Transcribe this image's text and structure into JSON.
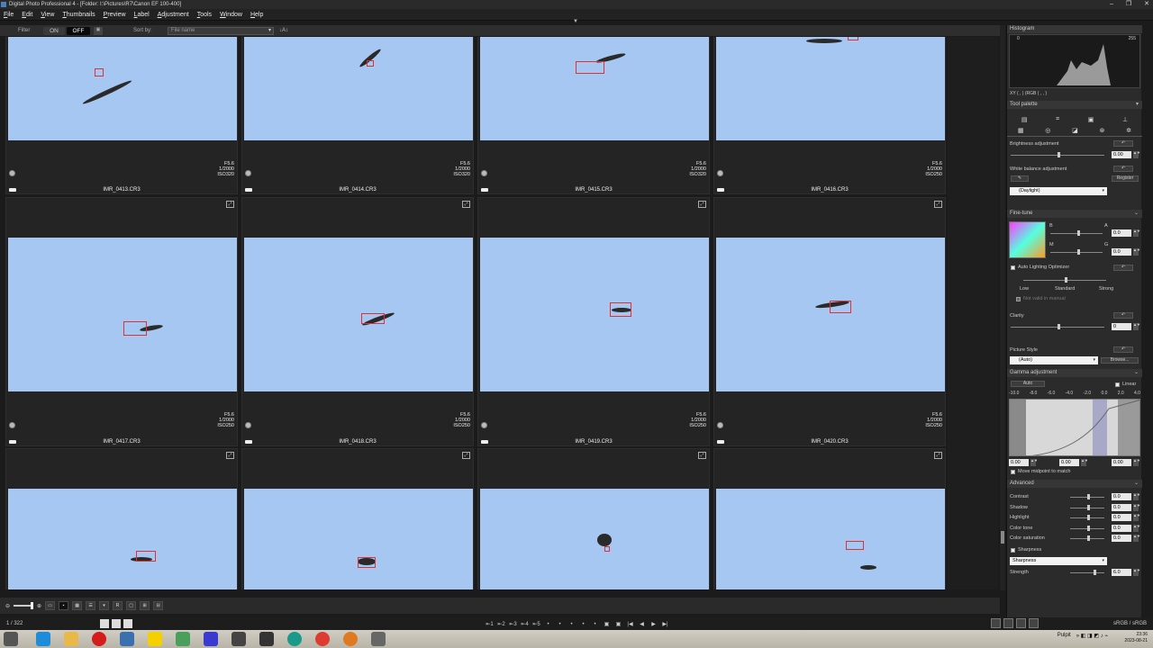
{
  "window": {
    "title": "Digital Photo Professional 4 - [Folder: I:\\Pictures\\R7\\Canon EF 100-400]",
    "minimize": "–",
    "maximize": "❐",
    "close": "✕"
  },
  "menu": [
    "File",
    "Edit",
    "View",
    "Thumbnails",
    "Preview",
    "Label",
    "Adjustment",
    "Tools",
    "Window",
    "Help"
  ],
  "filterbar": {
    "filter_label": "Filter",
    "on": "ON",
    "off": "OFF",
    "lock": "🔒",
    "sort_label": "Sort by:",
    "sort_value": "File name",
    "sort_dir": "↓A↕"
  },
  "thumbs": [
    {
      "name": "IMR_0413.CR3",
      "f": "F5.6",
      "t": "1/2000",
      "iso": "ISO320"
    },
    {
      "name": "IMR_0414.CR3",
      "f": "F5.6",
      "t": "1/2000",
      "iso": "ISO320"
    },
    {
      "name": "IMR_0415.CR3",
      "f": "F5.6",
      "t": "1/2000",
      "iso": "ISO320"
    },
    {
      "name": "IMR_0416.CR3",
      "f": "F5.6",
      "t": "1/2000",
      "iso": "ISO250"
    },
    {
      "name": "IMR_0417.CR3",
      "f": "F5.6",
      "t": "1/2000",
      "iso": "ISO250"
    },
    {
      "name": "IMR_0418.CR3",
      "f": "F5.6",
      "t": "1/2000",
      "iso": "ISO250"
    },
    {
      "name": "IMR_0419.CR3",
      "f": "F5.6",
      "t": "1/2000",
      "iso": "ISO250"
    },
    {
      "name": "IMR_0420.CR3",
      "f": "F5.6",
      "t": "1/2000",
      "iso": "ISO250"
    },
    {
      "name": "",
      "f": "",
      "t": "",
      "iso": ""
    },
    {
      "name": "",
      "f": "",
      "t": "",
      "iso": ""
    },
    {
      "name": "",
      "f": "",
      "t": "",
      "iso": ""
    },
    {
      "name": "",
      "f": "",
      "t": "",
      "iso": ""
    }
  ],
  "panel": {
    "histogram": {
      "title": "Histogram",
      "min": "0",
      "max": "255",
      "readout": "XY (  ,  )  (RGB (  ,  ,  )"
    },
    "tool_palette": "Tool palette",
    "brightness": {
      "label": "Brightness adjustment",
      "value": "0.00"
    },
    "white_balance": {
      "label": "White balance adjustment",
      "preset": "(Daylight)",
      "register": "Register"
    },
    "fine_tune": {
      "label": "Fine-tune",
      "b": "B",
      "a": "A",
      "m": "M",
      "g": "G",
      "val1": "0.0",
      "val2": "0.0"
    },
    "alo": {
      "label": "Auto Lighting Optimizer",
      "low": "Low",
      "standard": "Standard",
      "strong": "Strong",
      "disable": "Not valid in manual"
    },
    "clarity": {
      "label": "Clarity",
      "value": "0"
    },
    "picture_style": {
      "label": "Picture Style",
      "value": "(Auto)",
      "browse": "Browse..."
    },
    "gamma": {
      "label": "Gamma adjustment",
      "auto": "Auto",
      "linear": "Linear",
      "scale": [
        "-10.0",
        "-8.0",
        "-6.0",
        "-4.0",
        "-2.0",
        "0.0",
        "2.0",
        "4.0"
      ],
      "v1": "0.00",
      "v2": "0.00",
      "v3": "0.00",
      "move_midpoint": "Move midpoint to match"
    },
    "advanced": {
      "label": "Advanced",
      "rows": [
        {
          "name": "Contrast",
          "value": "0.0"
        },
        {
          "name": "Shadow",
          "value": "0.0"
        },
        {
          "name": "Highlight",
          "value": "0.0"
        },
        {
          "name": "Color tone",
          "value": "0.0"
        },
        {
          "name": "Color saturation",
          "value": "0.0"
        }
      ]
    },
    "sharpness": {
      "label": "Sharpness",
      "mode": "Sharpness",
      "strength_label": "Strength",
      "strength": "6.0"
    }
  },
  "status": {
    "count": "1 / 322",
    "colorspace": "sRGB / sRGB"
  },
  "navbar": [
    "⇤1",
    "⇤2",
    "⇤3",
    "⇤4",
    "⇤5",
    "•",
    "•",
    "•",
    "•",
    "•",
    "▣",
    "▣",
    "|◀",
    "◀",
    "▶",
    "▶|"
  ],
  "taskbar": {
    "pulpit": "Pulpit",
    "time": "23:36",
    "date": "2023-08-21"
  },
  "colors": {
    "sky": "#a5c7f2",
    "af_box": "#e03030",
    "panel_bg": "#2b2b2b"
  }
}
